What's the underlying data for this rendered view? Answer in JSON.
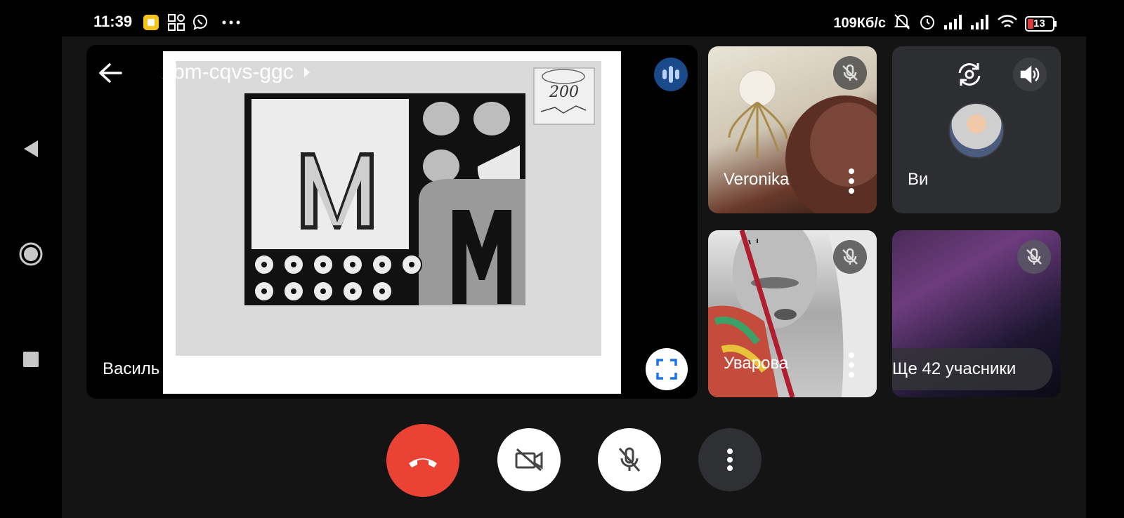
{
  "status_bar": {
    "time": "11:39",
    "network_speed": "109Кб/с",
    "battery": "13",
    "icons": [
      "notification-app-icon",
      "grid-apps-icon",
      "viber-icon",
      "more-dots-icon",
      "bell-muted-icon",
      "alarm-icon",
      "signal-icon",
      "signal-icon",
      "wifi-icon",
      "battery-icon"
    ]
  },
  "nav": {
    "icons": [
      "back-triangle-icon",
      "home-circle-icon",
      "recents-square-icon"
    ]
  },
  "presentation": {
    "meeting_code": "xbm-cqvs-ggc",
    "presenter_text": "Василь веде презентацію",
    "slide_stamp": "200"
  },
  "participants": [
    {
      "name": "Veronika",
      "muted": true
    },
    {
      "name": "Ви",
      "muted": false
    },
    {
      "name": "Уварова",
      "muted": true
    }
  ],
  "more_participants": "Ще 42 учасники",
  "colors": {
    "end_call": "#ea4335",
    "speaking_indicator": "#1a4a8a",
    "tile_bg": "#2d2e31"
  }
}
